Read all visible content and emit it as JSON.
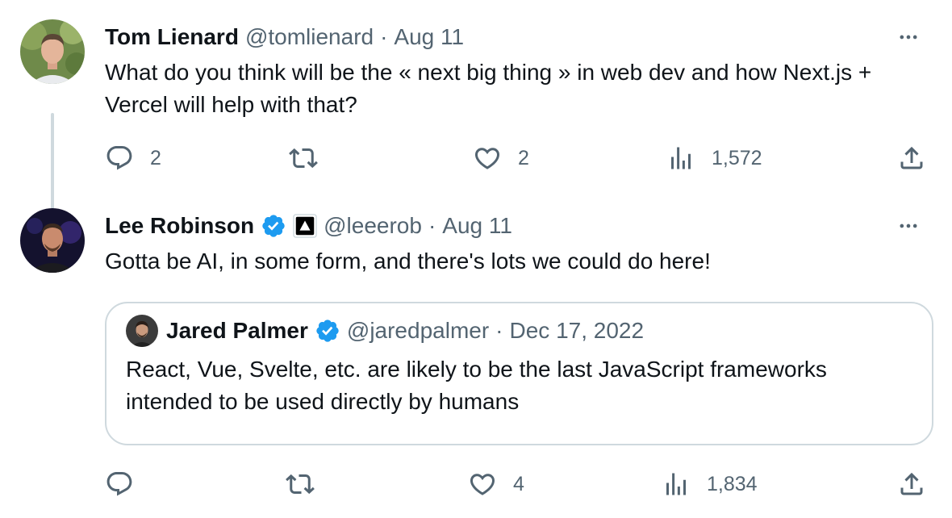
{
  "tweets": [
    {
      "name": "Tom Lienard",
      "handle": "@tomlienard",
      "separator": "·",
      "time": "Aug 11",
      "text": "What do you think will be the « next big thing » in web dev and how Next.js + Vercel will help with that?",
      "actions": {
        "replies": "2",
        "retweets": "",
        "likes": "2",
        "views": "1,572"
      },
      "avatar_icon": "avatar-tom-lienard"
    },
    {
      "name": "Lee Robinson",
      "handle": "@leeerob",
      "separator": "·",
      "time": "Aug 11",
      "verified": true,
      "affiliate_icon": "vercel-triangle-icon",
      "text": "Gotta be AI, in some form, and there's lots we could do here!",
      "actions": {
        "replies": "",
        "retweets": "",
        "likes": "4",
        "views": "1,834"
      },
      "avatar_icon": "avatar-lee-robinson",
      "quote": {
        "name": "Jared Palmer",
        "handle": "@jaredpalmer",
        "separator": "·",
        "time": "Dec 17, 2022",
        "verified": true,
        "text": "React, Vue, Svelte, etc. are likely to be the last JavaScript frameworks intended to be used directly by humans"
      }
    }
  ],
  "colors": {
    "text_primary": "#0f1419",
    "text_secondary": "#536471",
    "verified_blue": "#1d9bf0",
    "border": "#cfd9de"
  }
}
